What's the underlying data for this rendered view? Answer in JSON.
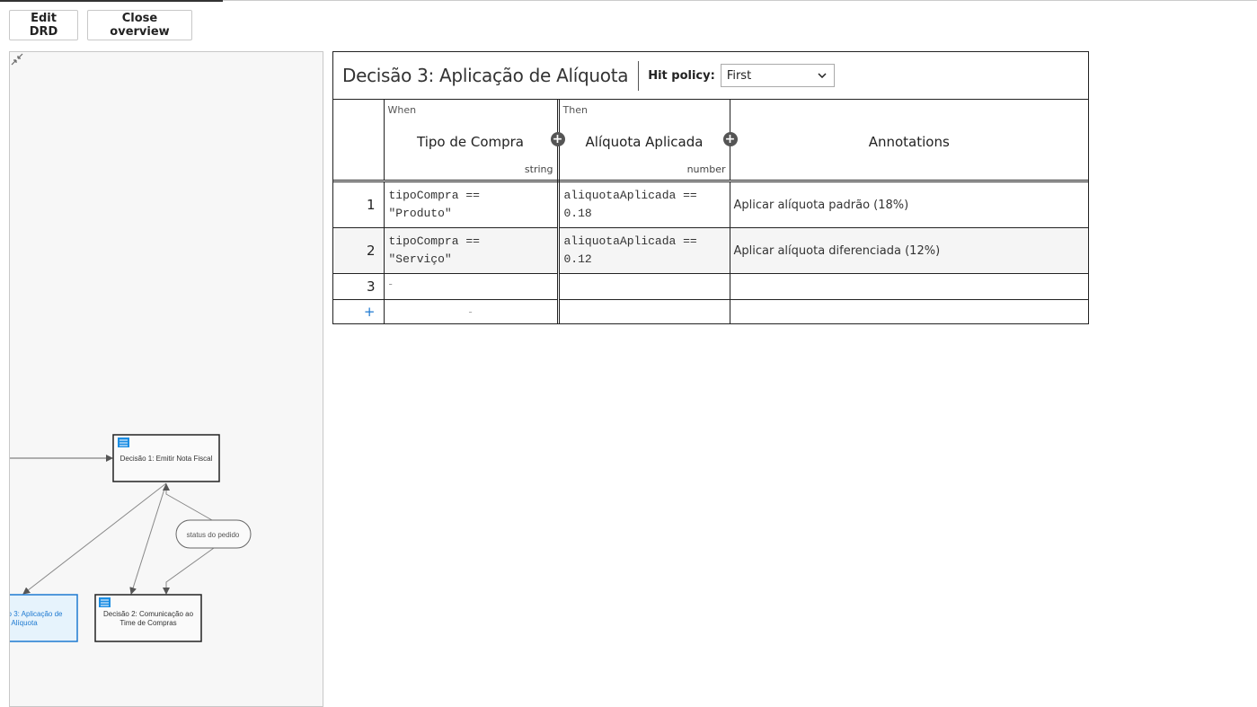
{
  "toolbar": {
    "edit_drd_label": "Edit DRD",
    "close_overview_label": "Close overview"
  },
  "drd": {
    "nodes": [
      {
        "label_line1": "Decisão 1: Emitir Nota Fiscal",
        "label_line2": ""
      },
      {
        "label_line1": "Decisão 2: Comunicação ao",
        "label_line2": "Time de Compras"
      },
      {
        "label_line1": "o 3: Aplicação de",
        "label_line2": "Alíquota"
      }
    ],
    "input_data_label": "status do pedido",
    "colors": {
      "selected": "#1f7ad1",
      "selected_fill": "#e6f3fc",
      "decision_icon": "#1c8ee3"
    }
  },
  "decision": {
    "title": "Decisão 3: Aplicação de Alíquota",
    "hit_policy_label": "Hit policy:",
    "hit_policy_value": "First",
    "input_kind": "When",
    "input_label": "Tipo de Compra",
    "input_type": "string",
    "output_kind": "Then",
    "output_label": "Alíquota Aplicada",
    "output_type": "number",
    "annotations_label": "Annotations",
    "rules": [
      {
        "num": "1",
        "input": "tipoCompra ==\n\"Produto\"",
        "output": "aliquotaAplicada ==\n0.18",
        "annotation": "Aplicar alíquota padrão (18%)"
      },
      {
        "num": "2",
        "input": "tipoCompra ==\n\"Serviço\"",
        "output": "aliquotaAplicada ==\n0.12",
        "annotation": "Aplicar alíquota diferenciada (12%)"
      },
      {
        "num": "3",
        "input": "-",
        "output": "",
        "annotation": ""
      }
    ],
    "add_row_symbol": "+",
    "add_row_input_placeholder": "-"
  }
}
